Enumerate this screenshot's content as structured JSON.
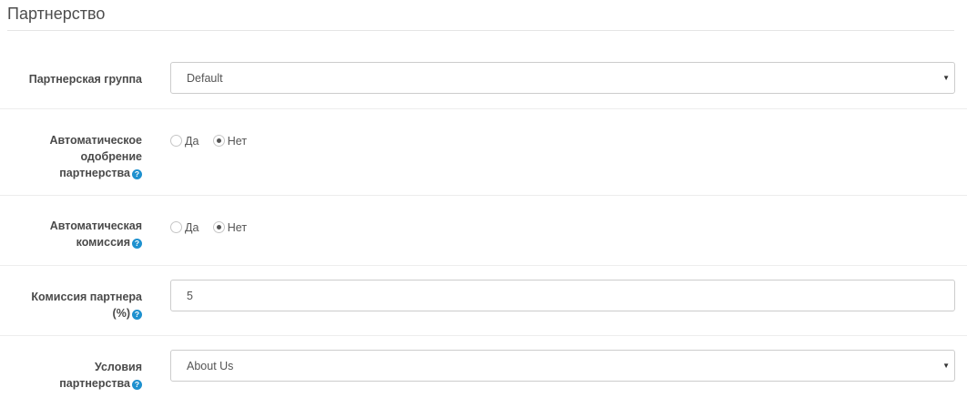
{
  "legend": {
    "title": "Партнерство"
  },
  "affiliate_group": {
    "label": "Партнерская группа",
    "value": "Default"
  },
  "auto_approve": {
    "label_lines": [
      "Автоматическое",
      "одобрение",
      "партнерства"
    ],
    "options": [
      {
        "label": "Да",
        "checked": false
      },
      {
        "label": "Нет",
        "checked": true
      }
    ]
  },
  "auto_commission": {
    "label_lines": [
      "Автоматическая",
      "комиссия"
    ],
    "options": [
      {
        "label": "Да",
        "checked": false
      },
      {
        "label": "Нет",
        "checked": true
      }
    ]
  },
  "commission": {
    "label_lines": [
      "Комиссия партнера",
      "(%)"
    ],
    "value": "5"
  },
  "terms": {
    "label_lines": [
      "Условия",
      "партнерства"
    ],
    "value": "About Us"
  },
  "help_icon_glyph": "?",
  "caret_glyph": "▼",
  "colors": {
    "help_icon": "#1e91cf",
    "border": "#cccccc"
  }
}
